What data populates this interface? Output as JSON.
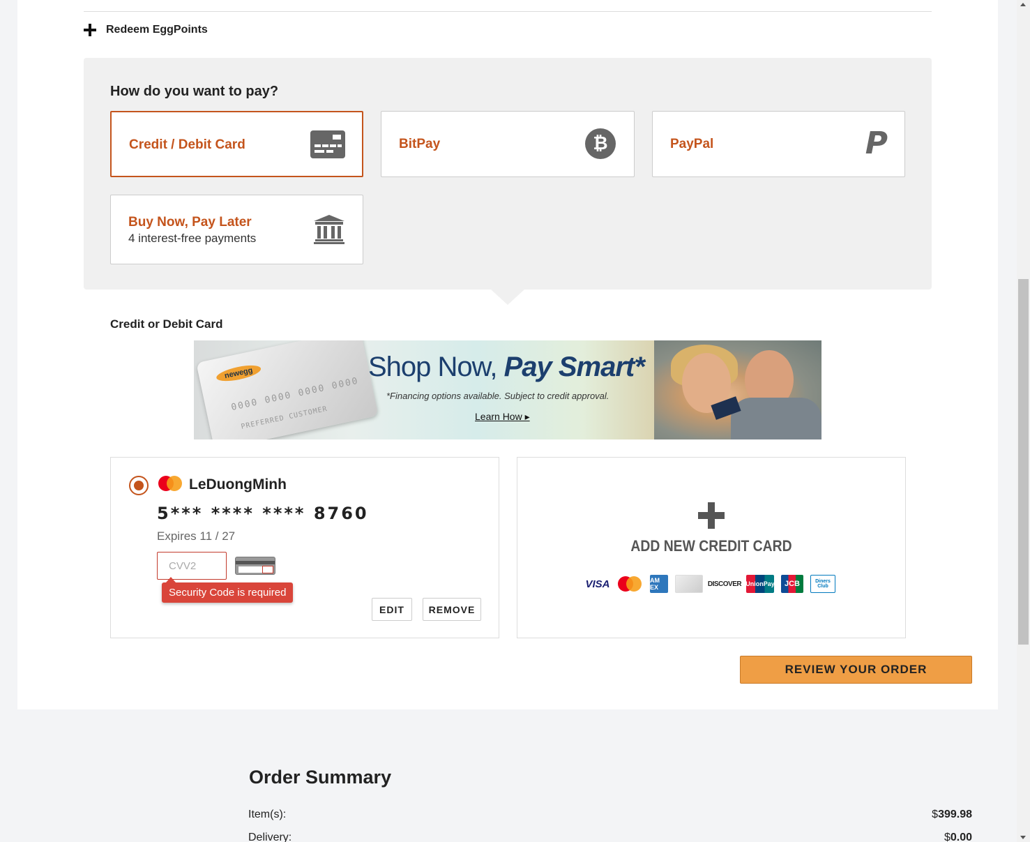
{
  "redeem": {
    "label": "Redeem EggPoints"
  },
  "payment": {
    "title": "How do you want to pay?",
    "options": [
      {
        "label": "Credit / Debit Card",
        "icon": "credit-card-icon",
        "selected": true
      },
      {
        "label": "BitPay",
        "icon": "bitcoin-icon",
        "glyph": "₿"
      },
      {
        "label": "PayPal",
        "icon": "paypal-icon",
        "glyph": "P"
      },
      {
        "label": "Buy Now, Pay Later",
        "sublabel": "4 interest-free payments",
        "icon": "bank-icon"
      }
    ]
  },
  "credit_section": {
    "heading": "Credit or Debit Card",
    "banner": {
      "logo": "newegg",
      "card_number": "0000 0000 0000 0000",
      "card_holder": "PREFERRED CUSTOMER",
      "headline_regular": "Shop Now, ",
      "headline_bold": "Pay Smart*",
      "note": "*Financing options available. Subject to credit approval.",
      "link": "Learn How ▸"
    }
  },
  "saved_card": {
    "brand_icon": "mastercard-icon",
    "holder": "LeDuongMinh",
    "number": "5*** **** **** 8760",
    "expires": "Expires 11 / 27",
    "cvv_placeholder": "CVV2",
    "cvv_value": "",
    "error": "Security Code is required",
    "edit_label": "EDIT",
    "remove_label": "REMOVE"
  },
  "add_card": {
    "label": "ADD NEW CREDIT CARD",
    "brands": [
      {
        "name": "visa-icon",
        "text": "VISA"
      },
      {
        "name": "mastercard-icon",
        "text": ""
      },
      {
        "name": "amex-icon",
        "text": "AM EX"
      },
      {
        "name": "generic-card-icon",
        "text": ""
      },
      {
        "name": "discover-icon",
        "text": "DISCOVER"
      },
      {
        "name": "unionpay-icon",
        "text": "UnionPay"
      },
      {
        "name": "jcb-icon",
        "text": "JCB"
      },
      {
        "name": "diners-club-icon",
        "text": "Diners Club"
      }
    ]
  },
  "review_button": {
    "label": "REVIEW YOUR ORDER"
  },
  "summary": {
    "title": "Order Summary",
    "rows": [
      {
        "label": "Item(s):",
        "currency": "$",
        "amount": "399.98"
      },
      {
        "label": "Delivery:",
        "currency": "$",
        "amount": "0.00"
      }
    ]
  },
  "colors": {
    "accent": "#c4541c",
    "button": "#ef9e45",
    "error": "#d9453a",
    "panel": "#f0f0f0"
  }
}
